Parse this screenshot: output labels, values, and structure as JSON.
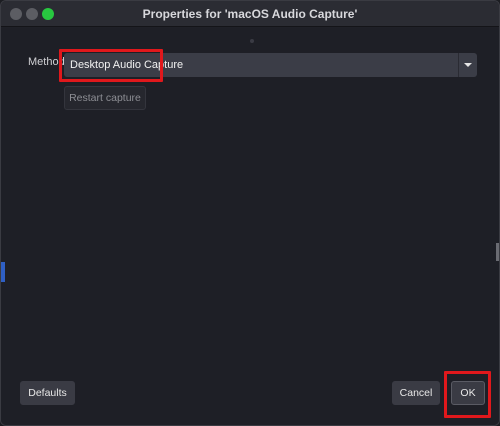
{
  "window": {
    "title": "Properties for 'macOS Audio Capture'"
  },
  "form": {
    "method_label": "Method",
    "method_value": "Desktop Audio Capture",
    "restart_label": "Restart capture"
  },
  "footer": {
    "defaults_label": "Defaults",
    "cancel_label": "Cancel",
    "ok_label": "OK"
  },
  "colors": {
    "highlight": "#e0181c",
    "zoom_button": "#28c840"
  }
}
